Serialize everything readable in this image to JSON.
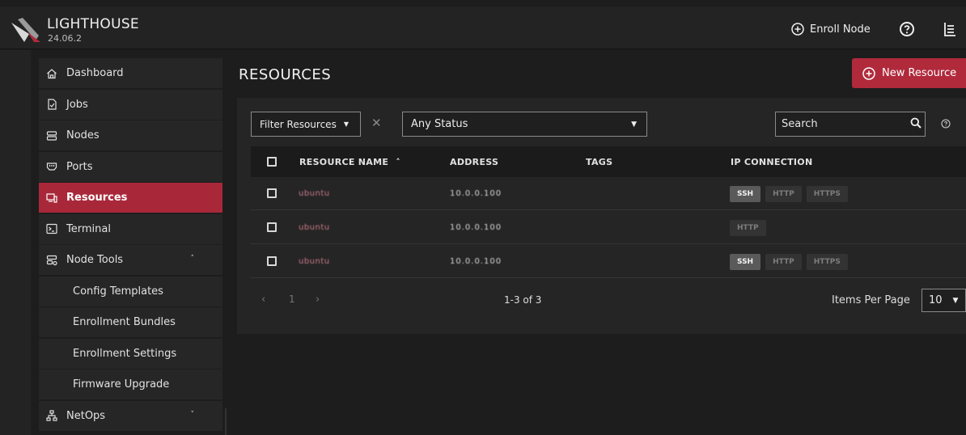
{
  "app": {
    "title": "LIGHTHOUSE",
    "version": "24.06.2"
  },
  "header": {
    "enroll_node_label": "Enroll Node",
    "icons": [
      "plus-circle-icon",
      "help-icon",
      "menu-icon"
    ]
  },
  "sidebar": {
    "items": [
      {
        "label": "Dashboard",
        "icon": "home-icon"
      },
      {
        "label": "Jobs",
        "icon": "jobs-icon"
      },
      {
        "label": "Nodes",
        "icon": "nodes-icon"
      },
      {
        "label": "Ports",
        "icon": "ports-icon"
      },
      {
        "label": "Resources",
        "icon": "resources-icon",
        "active": true
      },
      {
        "label": "Terminal",
        "icon": "terminal-icon"
      },
      {
        "label": "Node Tools",
        "icon": "node-tools-icon",
        "expanded": true
      }
    ],
    "node_tools_sub": [
      "Config Templates",
      "Enrollment Bundles",
      "Enrollment Settings",
      "Firmware Upgrade"
    ],
    "netops": {
      "label": "NetOps",
      "icon": "netops-icon"
    }
  },
  "page": {
    "title": "RESOURCES",
    "new_resource_label": "New Resource"
  },
  "filters": {
    "filter_label": "Filter Resources",
    "status_value": "Any Status",
    "search_placeholder": "Search"
  },
  "table": {
    "headers": {
      "name": "RESOURCE NAME",
      "address": "ADDRESS",
      "tags": "TAGS",
      "ip": "IP CONNECTION"
    },
    "rows": [
      {
        "name": "ubuntu",
        "address": "10.0.0.100",
        "tags": "",
        "connections": [
          "SSH",
          "HTTP",
          "HTTPS"
        ],
        "enabled": [
          "SSH"
        ]
      },
      {
        "name": "ubuntu",
        "address": "10.0.0.100",
        "tags": "",
        "connections": [
          "HTTP"
        ],
        "enabled": []
      },
      {
        "name": "ubuntu",
        "address": "10.0.0.100",
        "tags": "",
        "connections": [
          "SSH",
          "HTTP",
          "HTTPS"
        ],
        "enabled": [
          "SSH"
        ]
      }
    ]
  },
  "pagination": {
    "current_page": "1",
    "count_label": "1-3 of 3",
    "items_per_page_label": "Items Per Page",
    "items_per_page_value": "10"
  },
  "colors": {
    "accent": "#b02a3c",
    "active_nav": "#a8283a",
    "background": "#1d1d1d",
    "panel": "#252525"
  }
}
